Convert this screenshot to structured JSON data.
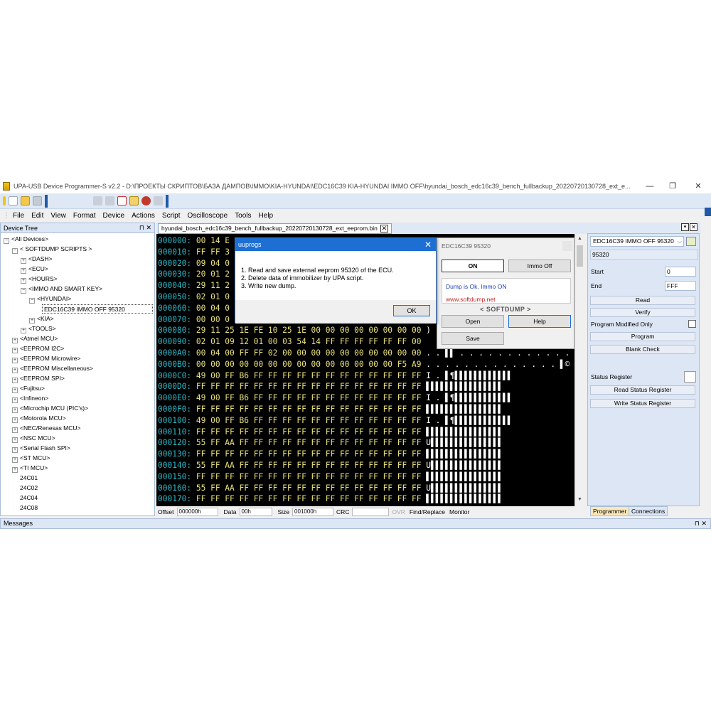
{
  "window": {
    "title": "UPA-USB Device Programmer-S v2.2 - D:\\ПРОЕКТЫ СКРИПТОВ\\БАЗА ДАМПОВ\\IMMO\\KIA-HYUNDAI\\EDC16C39 KIA-HYUNDAI IMMO OFF\\hyundai_bosch_edc16c39_bench_fullbackup_20220720130728_ext_e...",
    "minimize": "—",
    "restore": "❐",
    "close": "✕"
  },
  "menu": [
    "File",
    "Edit",
    "View",
    "Format",
    "Device",
    "Actions",
    "Script",
    "Oscilloscope",
    "Tools",
    "Help"
  ],
  "device_tree": {
    "header": "Device Tree",
    "pins": "⊓ ✕",
    "nodes": [
      "<All Devices>",
      "< SOFTDUMP SCRIPTS >",
      "<DASH>",
      "<ECU>",
      "<HOURS>",
      "<IMMO AND SMART KEY>",
      "<HYUNDAI>",
      "EDC16C39 IMMO OFF 95320",
      "<KIA>",
      "<TOOLS>",
      "<Atmel MCU>",
      "<EEPROM I2C>",
      "<EEPROM Microwire>",
      "<EEPROM Miscellaneous>",
      "<EEPROM SPI>",
      "<Fujitsu>",
      "<Infineon>",
      "<Microchip MCU (PIC's)>",
      "<Motorola MCU>",
      "<NEC/Renesas MCU>",
      "<NSC MCU>",
      "<Serial Flash SPI>",
      "<ST MCU>",
      "<TI MCU>",
      "24C01",
      "24C02",
      "24C04",
      "24C08"
    ]
  },
  "editor": {
    "tab": "hyundai_bosch_edc16c39_bench_fullbackup_20220720130728_ext_eeprom.bin",
    "rows": [
      {
        "addr": "000000:",
        "bytes": " 00 14 E",
        "ascii": ""
      },
      {
        "addr": "000010:",
        "bytes": " FF FF 3",
        "ascii": ""
      },
      {
        "addr": "000020:",
        "bytes": " 09 04 0",
        "ascii": ""
      },
      {
        "addr": "000030:",
        "bytes": " 20 01 2",
        "ascii": ""
      },
      {
        "addr": "000040:",
        "bytes": " 29 11 2",
        "ascii": ""
      },
      {
        "addr": "000050:",
        "bytes": " 02 01 0",
        "ascii": ""
      },
      {
        "addr": "000060:",
        "bytes": " 00 04 0",
        "ascii": ""
      },
      {
        "addr": "000070:",
        "bytes": " 00 00 0",
        "ascii": ""
      },
      {
        "addr": "000080:",
        "bytes": " 29 11 25 1E FE 10 25 1E 00 00 00 00 00 00 00 00",
        "ascii": " )"
      },
      {
        "addr": "000090:",
        "bytes": " 02 01 09 12 01 00 03 54 14 FF FF FF FF FF FF 00",
        "ascii": ""
      },
      {
        "addr": "0000A0:",
        "bytes": " 00 04 00 FF FF 02 00 00 00 00 00 00 00 00 00 00",
        "ascii": " . . ▌▌ . . . . . . . . . . . ."
      },
      {
        "addr": "0000B0:",
        "bytes": " 00 00 00 00 00 00 00 00 00 00 00 00 00 00 F5 A9",
        "ascii": " . . . . . . . . . . . . . . ▌©"
      },
      {
        "addr": "0000C0:",
        "bytes": " 49 00 FF B6 FF FF FF FF FF FF FF FF FF FF FF FF",
        "ascii": " I . ▌¶▌▌▌▌▌▌▌▌▌▌▌▌"
      },
      {
        "addr": "0000D0:",
        "bytes": " FF FF FF FF FF FF FF FF FF FF FF FF FF FF FF FF",
        "ascii": " ▌▌▌▌▌▌▌▌▌▌▌▌▌▌▌▌"
      },
      {
        "addr": "0000E0:",
        "bytes": " 49 00 FF B6 FF FF FF FF FF FF FF FF FF FF FF FF",
        "ascii": " I . ▌¶▌▌▌▌▌▌▌▌▌▌▌▌"
      },
      {
        "addr": "0000F0:",
        "bytes": " FF FF FF FF FF FF FF FF FF FF FF FF FF FF FF FF",
        "ascii": " ▌▌▌▌▌▌▌▌▌▌▌▌▌▌▌▌"
      },
      {
        "addr": "000100:",
        "bytes": " 49 00 FF B6 FF FF FF FF FF FF FF FF FF FF FF FF",
        "ascii": " I . ▌¶▌▌▌▌▌▌▌▌▌▌▌▌"
      },
      {
        "addr": "000110:",
        "bytes": " FF FF FF FF FF FF FF FF FF FF FF FF FF FF FF FF",
        "ascii": " ▌▌▌▌▌▌▌▌▌▌▌▌▌▌▌▌"
      },
      {
        "addr": "000120:",
        "bytes": " 55 FF AA FF FF FF FF FF FF FF FF FF FF FF FF FF",
        "ascii": " U▌▌▌▌▌▌▌▌▌▌▌▌▌▌▌"
      },
      {
        "addr": "000130:",
        "bytes": " FF FF FF FF FF FF FF FF FF FF FF FF FF FF FF FF",
        "ascii": " ▌▌▌▌▌▌▌▌▌▌▌▌▌▌▌▌"
      },
      {
        "addr": "000140:",
        "bytes": " 55 FF AA FF FF FF FF FF FF FF FF FF FF FF FF FF",
        "ascii": " U▌▌▌▌▌▌▌▌▌▌▌▌▌▌▌"
      },
      {
        "addr": "000150:",
        "bytes": " FF FF FF FF FF FF FF FF FF FF FF FF FF FF FF FF",
        "ascii": " ▌▌▌▌▌▌▌▌▌▌▌▌▌▌▌▌"
      },
      {
        "addr": "000160:",
        "bytes": " 55 FF AA FF FF FF FF FF FF FF FF FF FF FF FF FF",
        "ascii": " U▌▌▌▌▌▌▌▌▌▌▌▌▌▌▌"
      },
      {
        "addr": "000170:",
        "bytes": " FF FF FF FF FF FF FF FF FF FF FF FF FF FF FF FF",
        "ascii": " ▌▌▌▌▌▌▌▌▌▌▌▌▌▌▌▌"
      }
    ]
  },
  "statusbar": {
    "offset_label": "Offset",
    "offset_value": "000000h",
    "data_label": "Data",
    "data_value": "00h",
    "size_label": "Size",
    "size_value": "001000h",
    "crc_label": "CRC",
    "crc_value": "",
    "ovr": "OVR",
    "find_replace": "Find/Replace",
    "monitor": "Monitor"
  },
  "programmer": {
    "device_select": "EDC16C39 IMMO OFF 95320",
    "chip_name": "95320",
    "start_label": "Start",
    "start_value": "0",
    "end_label": "End",
    "end_value": "FFF",
    "read": "Read",
    "verify": "Verify",
    "program_modified_only": "Program Modified Only",
    "program": "Program",
    "blank_check": "Blank Check",
    "status_register": "Status Register",
    "read_status_register": "Read Status Register",
    "write_status_register": "Write Status Register",
    "tab_programmer": "Programmer",
    "tab_connections": "Connections"
  },
  "messages": {
    "label": "Messages",
    "pins": "⊓ ✕"
  },
  "dialog": {
    "title": "uuprogs",
    "close": "✕",
    "line1": "1. Read and save external eeprom 95320 of the ECU.",
    "line2": "2. Delete data of immobilizer by UPA script.",
    "line3": "3. Write new dump.",
    "ok": "OK"
  },
  "softdump": {
    "title": "EDC16C39 95320",
    "on": "ON",
    "immo_off": "Immo Off",
    "status": "Dump is Ok. Immo ON",
    "url": "www.softdump.net",
    "brand": "< SOFTDUMP >",
    "open": "Open",
    "help": "Help",
    "save": "Save"
  }
}
